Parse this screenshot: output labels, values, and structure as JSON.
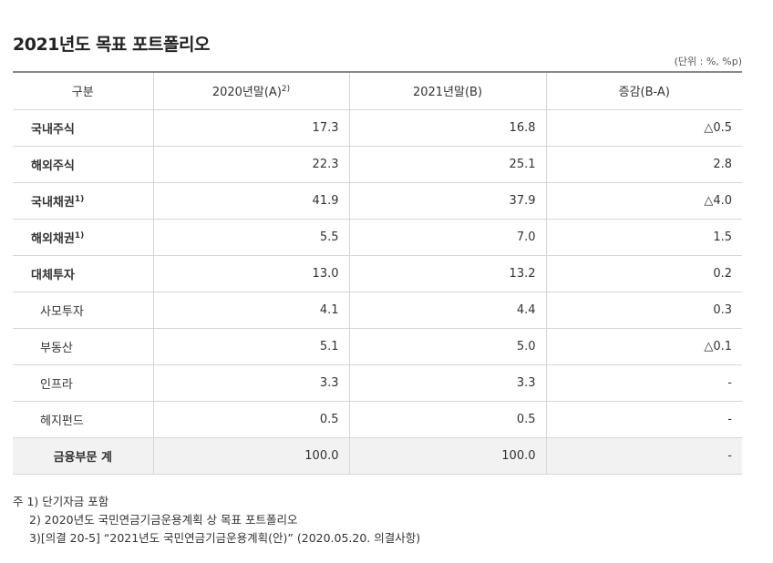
{
  "title": "2021년도 목표 포트폴리오",
  "unit": "(단위 : %, %p)",
  "table": {
    "headers": [
      {
        "label": "구분",
        "sup": ""
      },
      {
        "label": "2020년말(A)",
        "sup": "2)"
      },
      {
        "label": "2021년말(B)",
        "sup": ""
      },
      {
        "label": "증감(B-A)",
        "sup": ""
      }
    ],
    "rows": [
      {
        "label": "국내주식",
        "sup": "",
        "a": "17.3",
        "b": "16.8",
        "diff": "△0.5"
      },
      {
        "label": "해외주식",
        "sup": "",
        "a": "22.3",
        "b": "25.1",
        "diff": "2.8"
      },
      {
        "label": "국내채권",
        "sup": "1)",
        "a": "41.9",
        "b": "37.9",
        "diff": "△4.0"
      },
      {
        "label": "해외채권",
        "sup": "1)",
        "a": "5.5",
        "b": "7.0",
        "diff": "1.5"
      },
      {
        "label": "대체투자",
        "sup": "",
        "a": "13.0",
        "b": "13.2",
        "diff": "0.2"
      },
      {
        "label": "사모투자",
        "sup": "",
        "a": "4.1",
        "b": "4.4",
        "diff": "0.3"
      },
      {
        "label": "부동산",
        "sup": "",
        "a": "5.1",
        "b": "5.0",
        "diff": "△0.1"
      },
      {
        "label": "인프라",
        "sup": "",
        "a": "3.3",
        "b": "3.3",
        "diff": "-"
      },
      {
        "label": "헤지펀드",
        "sup": "",
        "a": "0.5",
        "b": "0.5",
        "diff": "-"
      }
    ],
    "total": {
      "label": "금융부문 계",
      "a": "100.0",
      "b": "100.0",
      "diff": "-"
    }
  },
  "notes": [
    "주 1) 단기자금 포함",
    "2) 2020년도 국민연금기금운용계획 상 목표 포트폴리오",
    "3)[의결 20-5] “2021년도 국민연금기금운용계획(안)” (2020.05.20. 의결사항)"
  ]
}
